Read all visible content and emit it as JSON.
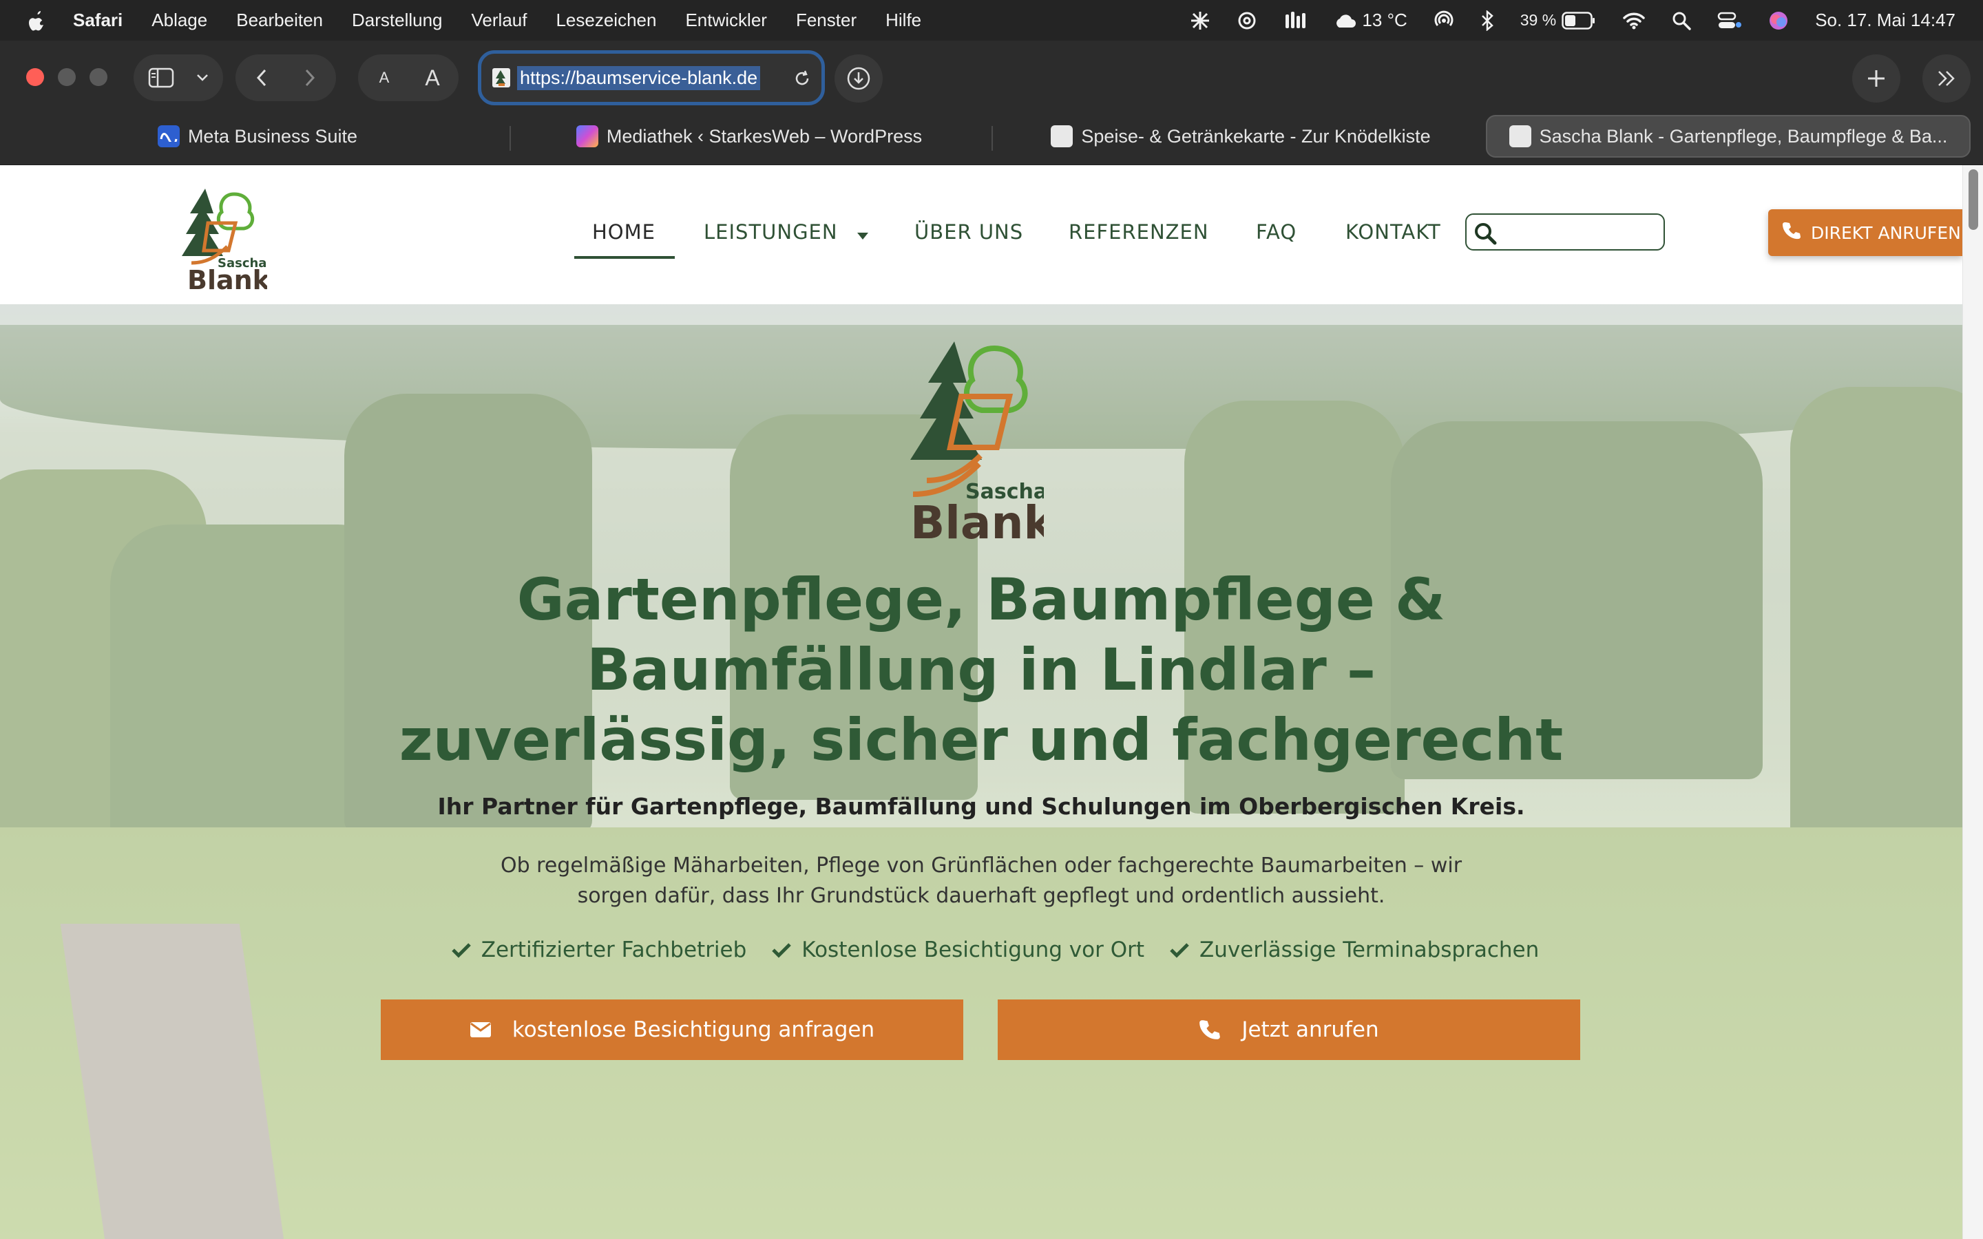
{
  "menubar": {
    "app_name": "Safari",
    "items": [
      "Ablage",
      "Bearbeiten",
      "Darstellung",
      "Verlauf",
      "Lesezeichen",
      "Entwickler",
      "Fenster",
      "Hilfe"
    ],
    "weather": "13 °C",
    "battery": "39 %",
    "datetime": "So. 17. Mai  14:47",
    "icons": [
      "apple-icon",
      "sparkle-icon",
      "chatgpt-icon",
      "activity-icon",
      "cloud-icon",
      "airdrop-icon",
      "bluetooth-icon",
      "battery-icon",
      "wifi-icon",
      "spotlight-icon",
      "control-center-icon",
      "siri-icon"
    ]
  },
  "toolbar": {
    "url": "https://baumservice-blank.de",
    "text_size_small": "A",
    "text_size_large": "A"
  },
  "tabs": [
    {
      "label": "Meta Business Suite",
      "active": false,
      "favicon_color": "#1877f2"
    },
    {
      "label": "Mediathek ‹ StarkesWeb – WordPress",
      "active": false,
      "favicon_color": "#6b4fbb"
    },
    {
      "label": "Speise- & Getränkekarte - Zur Knödelkiste",
      "active": false,
      "favicon_color": "#dddddd"
    },
    {
      "label": "Sascha Blank - Gartenpflege, Baumpflege & Ba...",
      "active": true,
      "favicon_color": "#dddddd"
    }
  ],
  "site": {
    "logo_first": "Sascha",
    "logo_last": "Blank",
    "nav": {
      "home": "HOME",
      "services": "LEISTUNGEN",
      "about": "ÜBER UNS",
      "references": "REFERENZEN",
      "faq": "FAQ",
      "contact": "KONTAKT"
    },
    "search_placeholder": "",
    "call_button": "DIREKT ANRUFEN",
    "colors": {
      "green": "#2f5135",
      "orange": "#d3772e",
      "light_green": "#5fae3a"
    }
  },
  "hero": {
    "title_line1": "Gartenpflege, Baumpflege &",
    "title_line2": "Baumfällung in Lindlar –",
    "title_line3": "zuverlässig, sicher und fachgerecht",
    "subtitle": "Ihr Partner für Gartenpflege, Baumfällung und Schulungen im Oberbergischen Kreis.",
    "text_line1": "Ob regelmäßige Mäharbeiten, Pflege von Grünflächen oder fachgerechte Baumarbeiten – wir",
    "text_line2": "sorgen dafür, dass Ihr Grundstück dauerhaft gepflegt und ordentlich aussieht.",
    "features": [
      "Zertifizierter Fachbetrieb",
      "Kostenlose Besichtigung vor Ort",
      "Zuverlässige Terminabsprachen"
    ],
    "button_inspection": "kostenlose Besichtigung anfragen",
    "button_call": "Jetzt anrufen"
  }
}
